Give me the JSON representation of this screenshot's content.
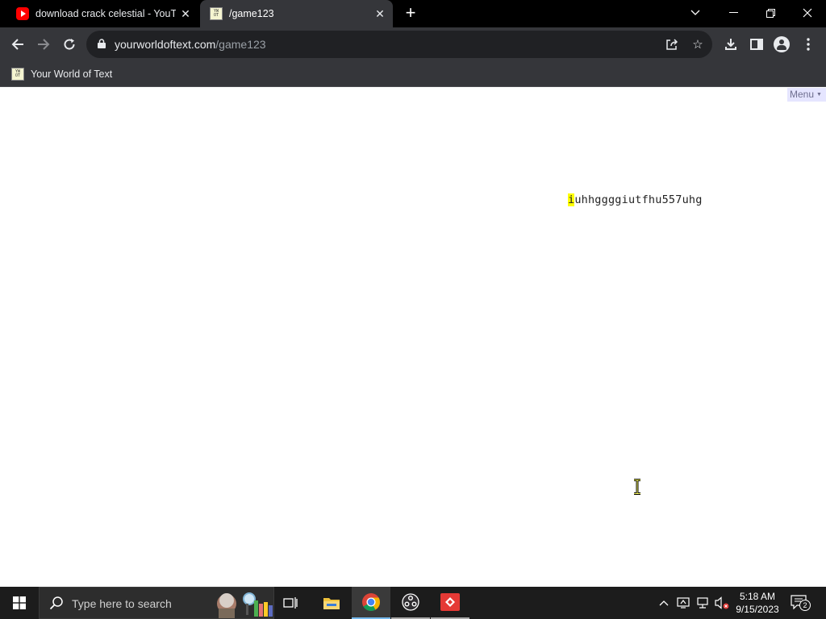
{
  "browser": {
    "tabs": [
      {
        "title": "download crack celestial - YouTube",
        "favicon": "youtube-icon",
        "active": false
      },
      {
        "title": "/game123",
        "favicon": "ywot-icon",
        "active": true
      }
    ],
    "new_tab": "+",
    "address": {
      "host": "yourworldoftext.com",
      "path": "/game123"
    },
    "bookmarks": [
      {
        "label": "Your World of Text",
        "favicon": "ywot-icon"
      }
    ]
  },
  "page": {
    "menu_label": "Menu",
    "cursor_char": "i",
    "text_rest": "uhhggggiutfhu557uhg"
  },
  "taskbar": {
    "search_placeholder": "Type here to search",
    "time": "5:18 AM",
    "date": "9/15/2023",
    "notification_count": "2"
  },
  "colors": {
    "tabstrip": "#000000",
    "toolbar": "#35363a",
    "omnibox": "#202124",
    "cursor_highlight": "#ffff00",
    "menu_bg": "#e5e5ff",
    "taskbar": "#1c1c1c"
  }
}
